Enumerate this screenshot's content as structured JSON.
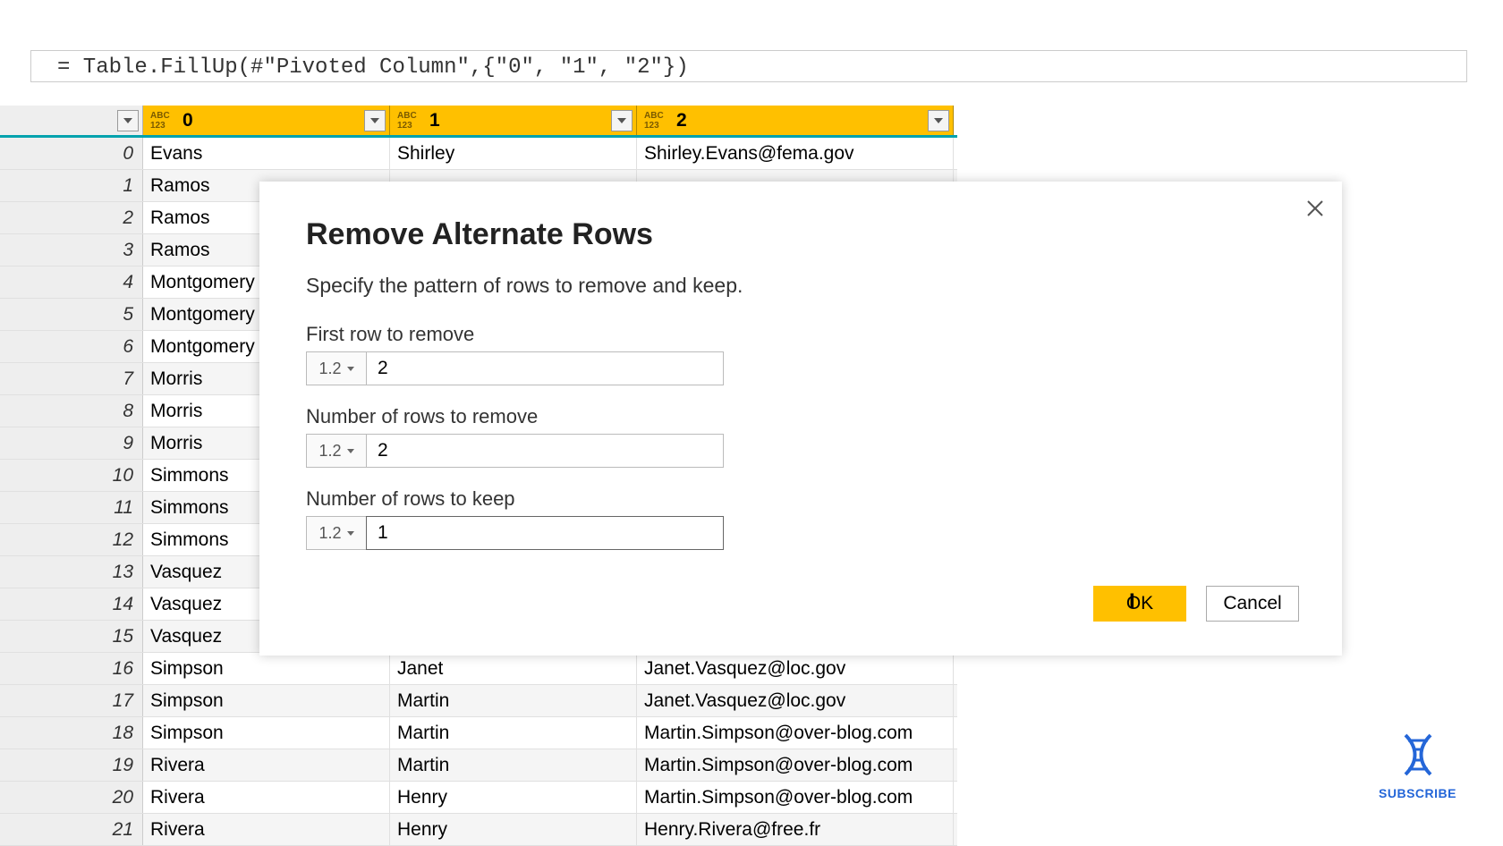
{
  "formula": "= Table.FillUp(#\"Pivoted Column\",{\"0\", \"1\", \"2\"})",
  "columns": [
    "0",
    "1",
    "2"
  ],
  "type_label": "1.2",
  "rows": [
    {
      "i": "0",
      "c0": "Evans",
      "c1": "Shirley",
      "c2": "Shirley.Evans@fema.gov"
    },
    {
      "i": "1",
      "c0": "Ramos",
      "c1": "",
      "c2": ""
    },
    {
      "i": "2",
      "c0": "Ramos",
      "c1": "",
      "c2": ""
    },
    {
      "i": "3",
      "c0": "Ramos",
      "c1": "",
      "c2": ""
    },
    {
      "i": "4",
      "c0": "Montgomery",
      "c1": "",
      "c2": ""
    },
    {
      "i": "5",
      "c0": "Montgomery",
      "c1": "",
      "c2": ""
    },
    {
      "i": "6",
      "c0": "Montgomery",
      "c1": "",
      "c2": ""
    },
    {
      "i": "7",
      "c0": "Morris",
      "c1": "",
      "c2": ""
    },
    {
      "i": "8",
      "c0": "Morris",
      "c1": "",
      "c2": ""
    },
    {
      "i": "9",
      "c0": "Morris",
      "c1": "",
      "c2": ""
    },
    {
      "i": "10",
      "c0": "Simmons",
      "c1": "",
      "c2": ""
    },
    {
      "i": "11",
      "c0": "Simmons",
      "c1": "",
      "c2": ""
    },
    {
      "i": "12",
      "c0": "Simmons",
      "c1": "",
      "c2": ""
    },
    {
      "i": "13",
      "c0": "Vasquez",
      "c1": "",
      "c2": ""
    },
    {
      "i": "14",
      "c0": "Vasquez",
      "c1": "",
      "c2": ""
    },
    {
      "i": "15",
      "c0": "Vasquez",
      "c1": "",
      "c2": ""
    },
    {
      "i": "16",
      "c0": "Simpson",
      "c1": "Janet",
      "c2": "Janet.Vasquez@loc.gov"
    },
    {
      "i": "17",
      "c0": "Simpson",
      "c1": "Martin",
      "c2": "Janet.Vasquez@loc.gov"
    },
    {
      "i": "18",
      "c0": "Simpson",
      "c1": "Martin",
      "c2": "Martin.Simpson@over-blog.com"
    },
    {
      "i": "19",
      "c0": "Rivera",
      "c1": "Martin",
      "c2": "Martin.Simpson@over-blog.com"
    },
    {
      "i": "20",
      "c0": "Rivera",
      "c1": "Henry",
      "c2": "Martin.Simpson@over-blog.com"
    },
    {
      "i": "21",
      "c0": "Rivera",
      "c1": "Henry",
      "c2": "Henry.Rivera@free.fr"
    }
  ],
  "dialog": {
    "title": "Remove Alternate Rows",
    "subtitle": "Specify the pattern of rows to remove and keep.",
    "label_first": "First row to remove",
    "label_remove": "Number of rows to remove",
    "label_keep": "Number of rows to keep",
    "val_first": "2",
    "val_remove": "2",
    "val_keep": "1",
    "ok": "OK",
    "cancel": "Cancel"
  },
  "badge": {
    "text": "SUBSCRIBE"
  }
}
